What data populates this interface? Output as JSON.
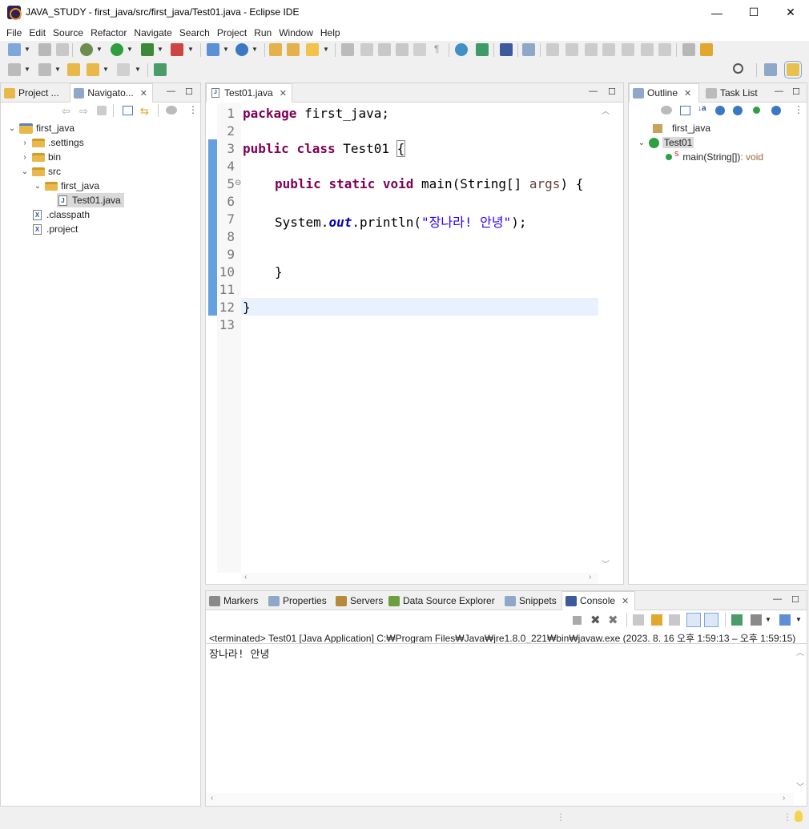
{
  "window": {
    "title": "JAVA_STUDY - first_java/src/first_java/Test01.java - Eclipse IDE",
    "minimize": "—",
    "maximize": "☐",
    "close": "✕"
  },
  "menu": [
    "File",
    "Edit",
    "Source",
    "Refactor",
    "Navigate",
    "Search",
    "Project",
    "Run",
    "Window",
    "Help"
  ],
  "left_panel": {
    "tabs": [
      {
        "label": "Project ...",
        "icon": "project-explorer-icon"
      },
      {
        "label": "Navigato...",
        "icon": "navigator-icon"
      }
    ],
    "tree": [
      {
        "label": "first_java",
        "level": 0,
        "expanded": true,
        "type": "project"
      },
      {
        "label": ".settings",
        "level": 1,
        "expanded": false,
        "type": "folder"
      },
      {
        "label": "bin",
        "level": 1,
        "expanded": false,
        "type": "folder"
      },
      {
        "label": "src",
        "level": 1,
        "expanded": true,
        "type": "folder"
      },
      {
        "label": "first_java",
        "level": 2,
        "expanded": true,
        "type": "folder"
      },
      {
        "label": "Test01.java",
        "level": 3,
        "type": "java",
        "selected": true
      },
      {
        "label": ".classpath",
        "level": 1,
        "type": "xml"
      },
      {
        "label": ".project",
        "level": 1,
        "type": "xml"
      }
    ]
  },
  "editor": {
    "tab_label": "Test01.java",
    "line_numbers": [
      "1",
      "2",
      "3",
      "4",
      "5",
      "6",
      "7",
      "8",
      "9",
      "10",
      "11",
      "12",
      "13"
    ],
    "code": {
      "l1_kw": "package",
      "l1_rest": " first_java;",
      "l3_kw1": "public",
      "l3_kw2": "class",
      "l3_rest": " Test01 ",
      "l3_brace": "{",
      "l5_kw1": "public",
      "l5_kw2": "static",
      "l5_kw3": "void",
      "l5_rest1": " main(String[] ",
      "l5_param": "args",
      "l5_rest2": ") {",
      "l7_a": "System.",
      "l7_field": "out",
      "l7_b": ".println(",
      "l7_str": "\"장나라! 안녕\"",
      "l7_c": ");",
      "l10": "}",
      "l12": "}"
    }
  },
  "outline_panel": {
    "tabs": [
      {
        "label": "Outline",
        "icon": "outline-icon"
      },
      {
        "label": "Task List",
        "icon": "task-list-icon"
      }
    ],
    "items": [
      {
        "label": "first_java",
        "type": "package"
      },
      {
        "label": "Test01",
        "type": "class"
      },
      {
        "label": "main(String[])",
        "suffix": " : void",
        "modifier": "S",
        "type": "method"
      }
    ]
  },
  "bottom_panel": {
    "tabs": [
      {
        "label": "Markers",
        "icon": "markers-icon"
      },
      {
        "label": "Properties",
        "icon": "properties-icon"
      },
      {
        "label": "Servers",
        "icon": "servers-icon"
      },
      {
        "label": "Data Source Explorer",
        "icon": "data-source-icon"
      },
      {
        "label": "Snippets",
        "icon": "snippets-icon"
      },
      {
        "label": "Console",
        "icon": "console-icon"
      }
    ],
    "console_header": "<terminated> Test01 [Java Application] C:₩Program Files₩Java₩jre1.8.0_221₩bin₩javaw.exe  (2023. 8. 16 오후 1:59:13 – 오후 1:59:15)",
    "console_output": "장나라!  안녕"
  },
  "colors": {
    "keyword": "#7f0055",
    "string": "#2a00ff",
    "field": "#0000c0",
    "current_line": "#e8f2fe",
    "change_marker": "#4a90d9"
  }
}
